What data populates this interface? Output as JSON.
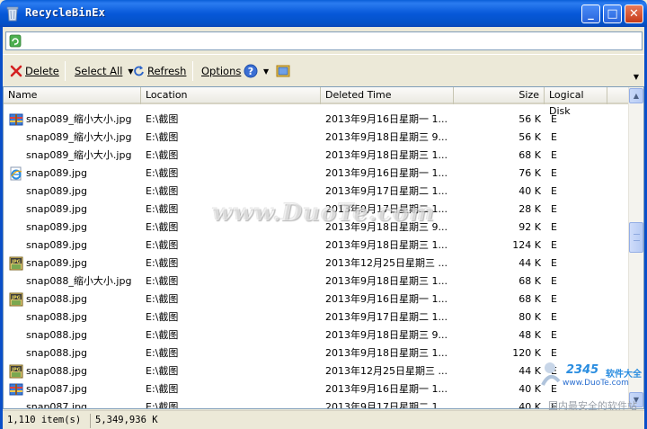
{
  "window": {
    "title": "RecycleBinEx",
    "buttons": {
      "minimize": "_",
      "maximize": "□",
      "close": "✕"
    }
  },
  "address": {
    "value": ""
  },
  "toolbar": {
    "delete_label": "Delete",
    "select_all_label": "Select All",
    "refresh_label": "Refresh",
    "options_label": "Options"
  },
  "columns": {
    "name": "Name",
    "location": "Location",
    "deleted_time": "Deleted Time",
    "size": "Size",
    "logical_disk": "Logical Disk"
  },
  "rows": [
    {
      "icon": "archive-icon",
      "name": "snap089_缩小大小.jpg",
      "location": "E:\\截图",
      "time": "2013年9月16日星期一 1...",
      "size": "56 K",
      "disk": "E"
    },
    {
      "icon": "",
      "name": "snap089_缩小大小.jpg",
      "location": "E:\\截图",
      "time": "2013年9月18日星期三 9...",
      "size": "56 K",
      "disk": "E"
    },
    {
      "icon": "",
      "name": "snap089_缩小大小.jpg",
      "location": "E:\\截图",
      "time": "2013年9月18日星期三 1...",
      "size": "68 K",
      "disk": "E"
    },
    {
      "icon": "ie-icon",
      "name": "snap089.jpg",
      "location": "E:\\截图",
      "time": "2013年9月16日星期一 1...",
      "size": "76 K",
      "disk": "E"
    },
    {
      "icon": "",
      "name": "snap089.jpg",
      "location": "E:\\截图",
      "time": "2013年9月17日星期二 1...",
      "size": "40 K",
      "disk": "E"
    },
    {
      "icon": "",
      "name": "snap089.jpg",
      "location": "E:\\截图",
      "time": "2013年9月17日星期二 1...",
      "size": "28 K",
      "disk": "E"
    },
    {
      "icon": "",
      "name": "snap089.jpg",
      "location": "E:\\截图",
      "time": "2013年9月18日星期三 9...",
      "size": "92 K",
      "disk": "E"
    },
    {
      "icon": "",
      "name": "snap089.jpg",
      "location": "E:\\截图",
      "time": "2013年9月18日星期三 1...",
      "size": "124 K",
      "disk": "E"
    },
    {
      "icon": "jpg-icon",
      "name": "snap089.jpg",
      "location": "E:\\截图",
      "time": "2013年12月25日星期三 ...",
      "size": "44 K",
      "disk": "E"
    },
    {
      "icon": "",
      "name": "snap088_缩小大小.jpg",
      "location": "E:\\截图",
      "time": "2013年9月18日星期三 1...",
      "size": "68 K",
      "disk": "E"
    },
    {
      "icon": "jpg-icon",
      "name": "snap088.jpg",
      "location": "E:\\截图",
      "time": "2013年9月16日星期一 1...",
      "size": "68 K",
      "disk": "E"
    },
    {
      "icon": "",
      "name": "snap088.jpg",
      "location": "E:\\截图",
      "time": "2013年9月17日星期二 1...",
      "size": "80 K",
      "disk": "E"
    },
    {
      "icon": "",
      "name": "snap088.jpg",
      "location": "E:\\截图",
      "time": "2013年9月18日星期三 9...",
      "size": "48 K",
      "disk": "E"
    },
    {
      "icon": "",
      "name": "snap088.jpg",
      "location": "E:\\截图",
      "time": "2013年9月18日星期三 1...",
      "size": "120 K",
      "disk": "E"
    },
    {
      "icon": "jpg-icon",
      "name": "snap088.jpg",
      "location": "E:\\截图",
      "time": "2013年12月25日星期三 ...",
      "size": "44 K",
      "disk": "E"
    },
    {
      "icon": "archive-icon",
      "name": "snap087.jpg",
      "location": "E:\\截图",
      "time": "2013年9月16日星期一 1...",
      "size": "40 K",
      "disk": "E"
    },
    {
      "icon": "",
      "name": "snap087.jpg",
      "location": "E:\\截图",
      "time": "2013年9月17日星期二 1...",
      "size": "40 K",
      "disk": "E"
    }
  ],
  "status": {
    "items": "1,110 item(s)",
    "total_size": "5,349,936 K"
  },
  "watermark": {
    "site": "www.DuoTe.com",
    "logo_number": "2345",
    "logo_text": "软件大全",
    "logo_url": "www.DuoTe.com",
    "slogan": "国内最安全的软件站"
  },
  "colors": {
    "title_bar": "#0758d9",
    "window_bg": "#ece9d8",
    "list_bg": "#ffffff"
  }
}
